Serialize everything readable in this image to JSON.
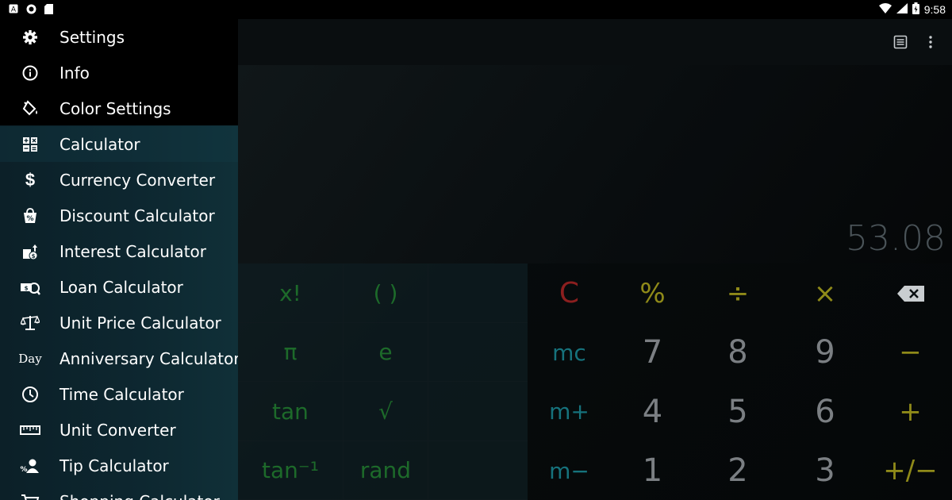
{
  "status_bar": {
    "time": "9:58",
    "left_icons": [
      "a-notification-icon",
      "circle-notification-icon",
      "sd-card-icon"
    ],
    "right_icons": [
      "wifi-icon",
      "signal-icon",
      "battery-icon"
    ]
  },
  "drawer": {
    "items": [
      {
        "label": "Settings",
        "icon": "gear-icon"
      },
      {
        "label": "Info",
        "icon": "info-icon"
      },
      {
        "label": "Color Settings",
        "icon": "paint-bucket-icon"
      },
      {
        "label": "Calculator",
        "icon": "calculator-icon",
        "selected": true
      },
      {
        "label": "Currency Converter",
        "icon": "dollar-icon"
      },
      {
        "label": "Discount Calculator",
        "icon": "discount-bag-icon"
      },
      {
        "label": "Interest Calculator",
        "icon": "interest-icon"
      },
      {
        "label": "Loan Calculator",
        "icon": "loan-icon"
      },
      {
        "label": "Unit Price Calculator",
        "icon": "scale-icon"
      },
      {
        "label": "Anniversary Calculator",
        "icon": "day-text-icon",
        "icon_text": "Day"
      },
      {
        "label": "Time Calculator",
        "icon": "clock-icon"
      },
      {
        "label": "Unit Converter",
        "icon": "ruler-icon"
      },
      {
        "label": "Tip Calculator",
        "icon": "tip-icon"
      },
      {
        "label": "Shopping Calculator",
        "icon": "cart-icon"
      }
    ]
  },
  "display": {
    "result": "53.08"
  },
  "toolbar": {
    "icons": [
      "history-icon",
      "more-vert-icon"
    ]
  },
  "keypad": {
    "row1": [
      "x!",
      "( )",
      "C",
      "%",
      "÷",
      "×",
      "backspace"
    ],
    "row2": [
      "π",
      "e",
      "mc",
      "7",
      "8",
      "9",
      "−"
    ],
    "row3": [
      "tan",
      "√",
      "m+",
      "4",
      "5",
      "6",
      "+"
    ],
    "row4": [
      "tan⁻¹",
      "rand",
      "m−",
      "1",
      "2",
      "3",
      "+/−"
    ]
  },
  "colors": {
    "drawer_bg": "#0d2730",
    "scientific_green": "#1d6a2a",
    "memory_teal": "#16727c",
    "clear_red": "#8c1f1f",
    "operator_gold": "#8f8a19",
    "number_gray": "#7b7f83",
    "result_gray": "#4a5358"
  }
}
